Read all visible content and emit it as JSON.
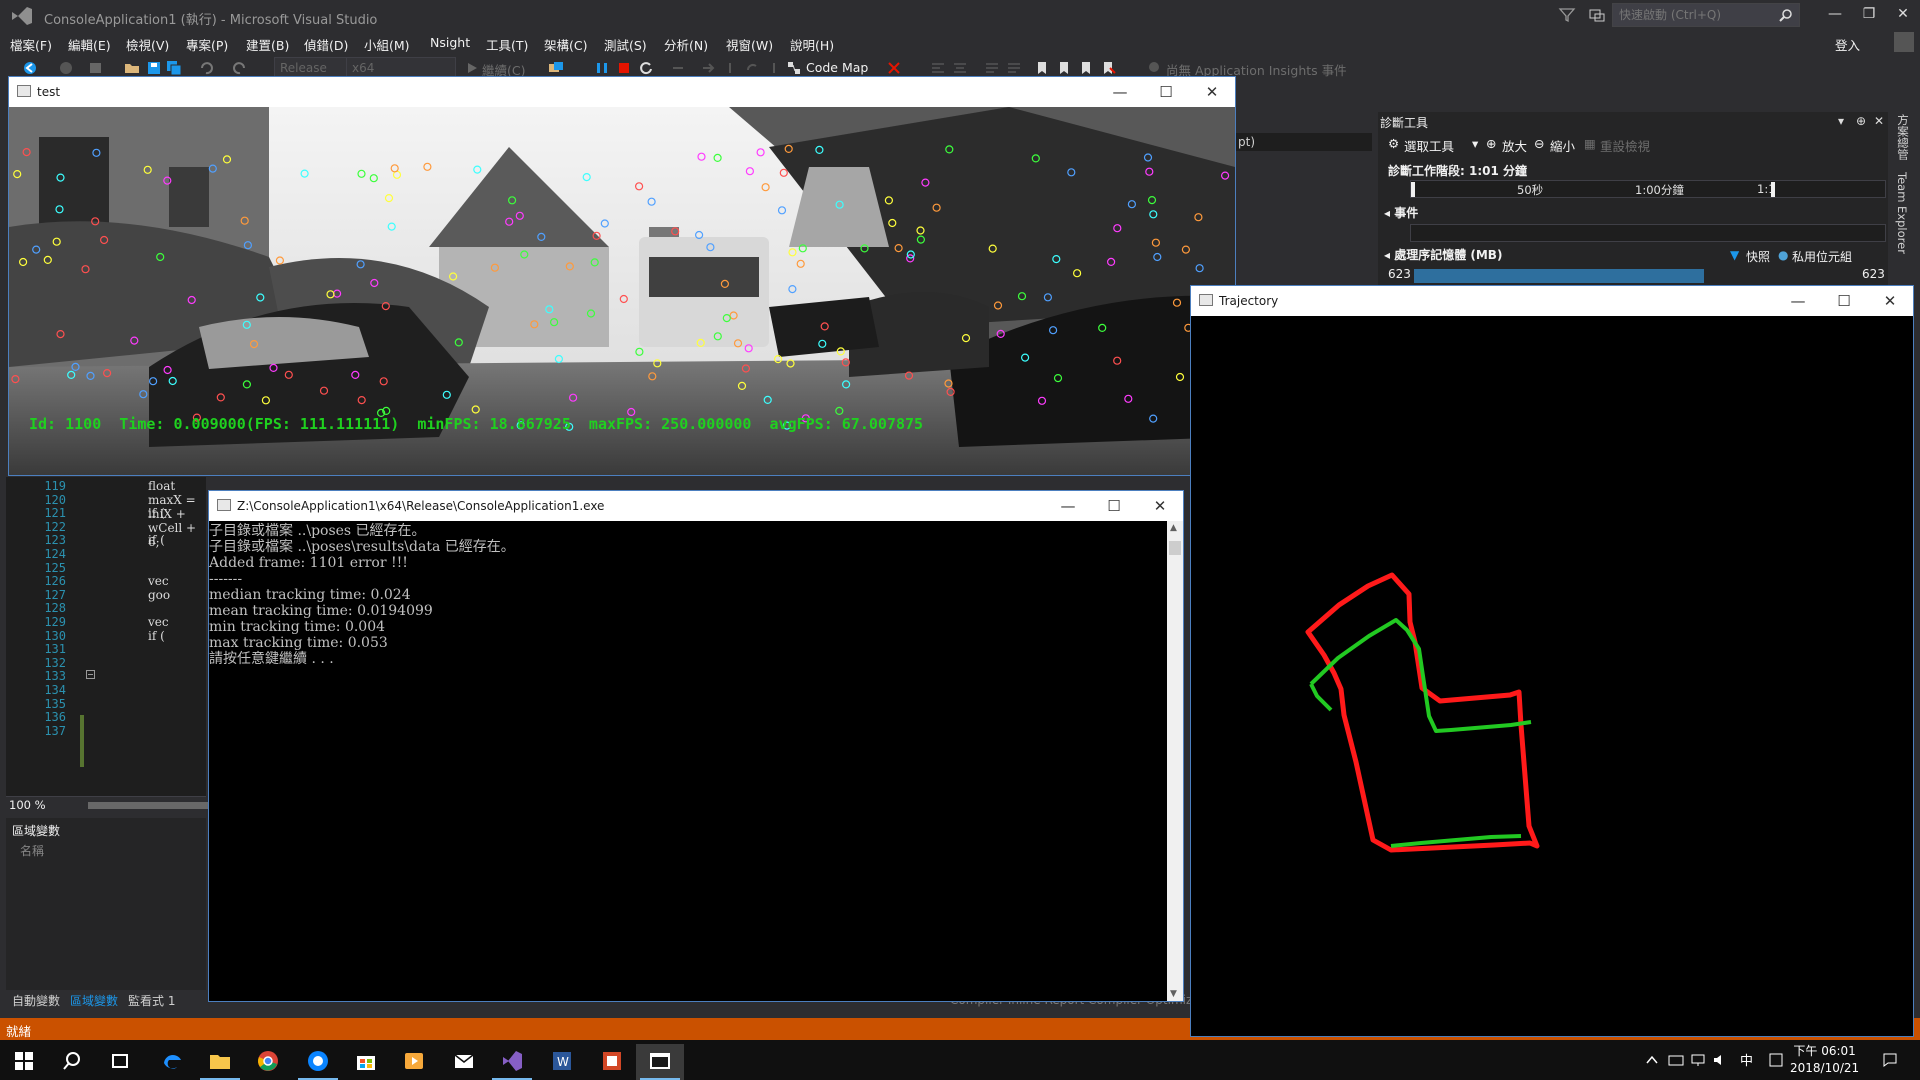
{
  "vs": {
    "title": "ConsoleApplication1 (執行) - Microsoft Visual Studio",
    "quick_launch_placeholder": "快速啟動 (Ctrl+Q)",
    "login": "登入",
    "menu": [
      "檔案(F)",
      "編輯(E)",
      "檢視(V)",
      "專案(P)",
      "建置(B)",
      "偵錯(D)",
      "小組(M)",
      "Nsight",
      "工具(T)",
      "架構(C)",
      "測試(S)",
      "分析(N)",
      "視窗(W)",
      "說明(H)"
    ],
    "toolbar": {
      "config": "Release",
      "platform": "x64",
      "continue": "繼續(C)",
      "code_map": "Code Map",
      "app_insights": "尚無 Application Insights 事件"
    },
    "status": "就緒",
    "compiler_text": "Compiler Inline Report   Compiler Optimiz"
  },
  "editor": {
    "line_numbers": [
      "119",
      "120",
      "121",
      "122",
      "123",
      "124",
      "125",
      "126",
      "127",
      "128",
      "129",
      "130",
      "131",
      "132",
      "133",
      "134",
      "135",
      "136",
      "137"
    ],
    "code_fragments": [
      {
        "line": 0,
        "text": "float maxX = iniX + wCell + 6;"
      },
      {
        "line": 2,
        "text": "if ("
      },
      {
        "line": 4,
        "text": "if ("
      },
      {
        "line": 7,
        "text": "vec"
      },
      {
        "line": 8,
        "text": "goo"
      },
      {
        "line": 10,
        "text": "vec"
      },
      {
        "line": 11,
        "text": "if ("
      }
    ],
    "zoom": "100 %"
  },
  "locals": {
    "title": "區域變數",
    "col_name": "名稱",
    "tabs": [
      "自動變數",
      "區域變數",
      "監看式 1"
    ]
  },
  "diagnostics": {
    "title": "診斷工具",
    "select_tool": "選取工具",
    "zoom_in": "放大",
    "zoom_out": "縮小",
    "reset_view": "重設檢視",
    "session": "診斷工作階段: 1:01 分鐘",
    "ticks": [
      "50秒",
      "1:00分鐘",
      "1:1"
    ],
    "events": "事件",
    "memory": "處理序記憶體 (MB)",
    "snapshot": "快照",
    "private_bytes": "私用位元組",
    "mem_min": "623",
    "mem_max": "623"
  },
  "side_tabs": [
    "方案總管",
    "Team Explorer"
  ],
  "output_hint": "pt)",
  "test_window": {
    "title": "test",
    "hud": "Id: 1100  Time: 0.009000(FPS: 111.111111)  minFPS: 18.867925  maxFPS: 250.000000  avgFPS: 67.007875"
  },
  "console_window": {
    "title": "Z:\\ConsoleApplication1\\x64\\Release\\ConsoleApplication1.exe",
    "lines": [
      "子目錄或檔案 ..\\poses 已經存在。",
      "子目錄或檔案 ..\\poses\\results\\data 已經存在。",
      "Added frame: 1101 error !!!",
      "",
      "-------",
      "",
      "median tracking time: 0.024",
      "mean tracking time: 0.0194099",
      "min tracking time: 0.004",
      "max tracking time: 0.053",
      "請按任意鍵繼續 . . ."
    ]
  },
  "trajectory_window": {
    "title": "Trajectory",
    "colors": {
      "estimate": "#ff1a1a",
      "ground_truth": "#22c922"
    }
  },
  "taskbar": {
    "apps": [
      "start-icon",
      "search-icon",
      "task-view-icon",
      "edge-icon",
      "file-explorer-icon",
      "chrome-icon",
      "firefox-icon",
      "store-icon",
      "media-player-icon",
      "mail-icon",
      "visual-studio-icon",
      "word-icon",
      "office-icon",
      "console-icon"
    ],
    "ime": "中",
    "time": "下午 06:01",
    "date": "2018/10/21"
  },
  "colors": {
    "vs_bg": "#2d2d30",
    "status_bar": "#ca5100",
    "hud_green": "#1fd11f"
  }
}
